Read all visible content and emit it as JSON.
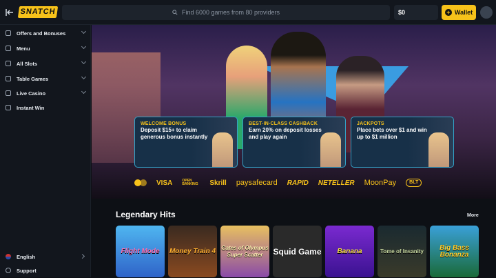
{
  "header": {
    "brand": "SNATCH",
    "search_placeholder": "Find 6000 games from 80 providers",
    "balance": "$0",
    "wallet_label": "Wallet"
  },
  "sidebar": {
    "items": [
      {
        "label": "Offers and Bonuses",
        "icon": "gift-icon"
      },
      {
        "label": "Menu",
        "icon": "menu-icon"
      },
      {
        "label": "All Slots",
        "icon": "slots-icon"
      },
      {
        "label": "Table Games",
        "icon": "table-icon"
      },
      {
        "label": "Live Casino",
        "icon": "live-icon"
      },
      {
        "label": "Instant Win",
        "icon": "instant-icon"
      }
    ],
    "language": "English",
    "support": "Support"
  },
  "promos": [
    {
      "title": "WELCOME BONUS",
      "desc": "Deposit $15+ to claim generous bonus instantly"
    },
    {
      "title": "BEST-IN-CLASS CASHBACK",
      "desc": "Earn 20% on deposit losses and play again"
    },
    {
      "title": "JACKPOTS",
      "desc": "Place bets over $1 and win up to $1 million"
    }
  ],
  "payments": [
    "VISA",
    "OPEN BANKING",
    "Skrill",
    "paysafecard",
    "RAPID",
    "NETELLER",
    "MoonPay",
    "BLT"
  ],
  "section": {
    "title": "Legendary Hits",
    "more": "More"
  },
  "games": [
    "Flight Mode",
    "Money Train 4",
    "Gates of Olympus Super Scatter",
    "Squid Game",
    "Banana",
    "Tome of Insanity",
    "Big Bass Bonanza"
  ],
  "colors": {
    "accent": "#f7c21a",
    "bg": "#0d1015",
    "panel": "#12161d"
  }
}
